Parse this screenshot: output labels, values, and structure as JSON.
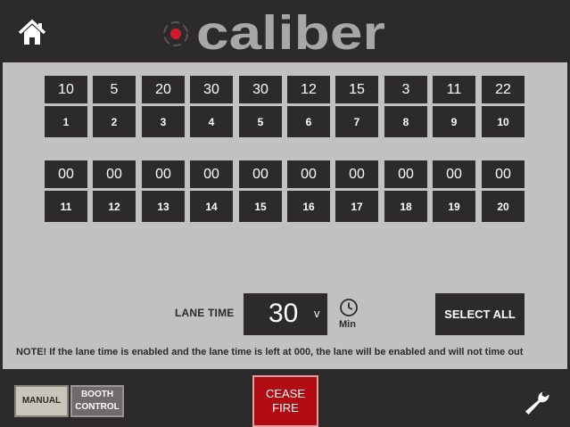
{
  "header": {
    "logo_text": "caliber",
    "home_icon": "home-icon"
  },
  "lanes_row1": [
    {
      "time": "10",
      "num": "1"
    },
    {
      "time": "5",
      "num": "2"
    },
    {
      "time": "20",
      "num": "3"
    },
    {
      "time": "30",
      "num": "4"
    },
    {
      "time": "30",
      "num": "5"
    },
    {
      "time": "12",
      "num": "6"
    },
    {
      "time": "15",
      "num": "7"
    },
    {
      "time": "3",
      "num": "8"
    },
    {
      "time": "11",
      "num": "9"
    },
    {
      "time": "22",
      "num": "10"
    }
  ],
  "lanes_row2": [
    {
      "time": "00",
      "num": "11"
    },
    {
      "time": "00",
      "num": "12"
    },
    {
      "time": "00",
      "num": "13"
    },
    {
      "time": "00",
      "num": "14"
    },
    {
      "time": "00",
      "num": "15"
    },
    {
      "time": "00",
      "num": "16"
    },
    {
      "time": "00",
      "num": "17"
    },
    {
      "time": "00",
      "num": "18"
    },
    {
      "time": "00",
      "num": "19"
    },
    {
      "time": "00",
      "num": "20"
    }
  ],
  "controls": {
    "lane_time_label": "LANE TIME",
    "lane_time_value": "30",
    "chevron": "v",
    "unit": "Min",
    "select_all": "SELECT ALL",
    "note": "NOTE! If the lane time is enabled and the lane time is left at 000, the lane will be enabled and will not time out"
  },
  "footer": {
    "manual": "MANUAL",
    "booth_line1": "BOOTH",
    "booth_line2": "CONTROL",
    "cease_line1": "CEASE",
    "cease_line2": "FIRE",
    "settings_icon": "wrench-icon"
  },
  "colors": {
    "background": "#2d2a2b",
    "panel": "#c1c1c1",
    "cease_fire": "#b10c12",
    "logo_red": "#d01c2a"
  }
}
